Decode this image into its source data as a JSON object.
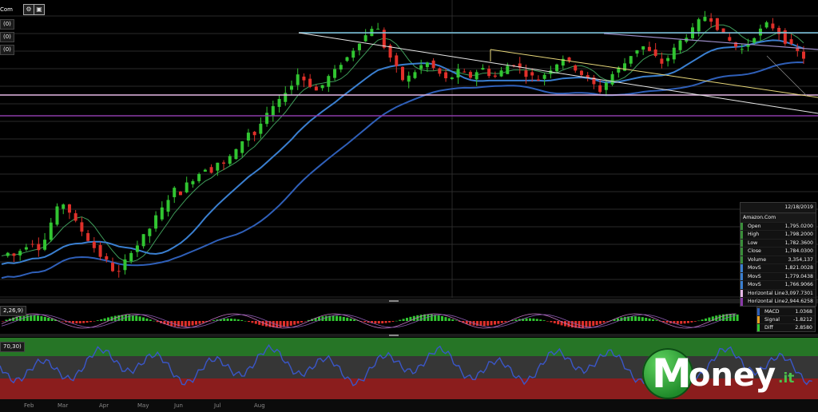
{
  "header": {
    "symbol_fragment": "Com"
  },
  "indicator_chips": [
    "(0)",
    "(0)",
    "(0)"
  ],
  "ohlc_panel": {
    "date": "12/18/2019",
    "symbol": "Amazon.Com",
    "rows": [
      {
        "label": "Open",
        "value": "1,795.0200"
      },
      {
        "label": "High",
        "value": "1,798.2000"
      },
      {
        "label": "Low",
        "value": "1,782.3600"
      },
      {
        "label": "Close",
        "value": "1,784.0300"
      },
      {
        "label": "Volume",
        "value": "3,354,137"
      },
      {
        "label": "MovS",
        "value": "1,821.0028"
      },
      {
        "label": "MovS",
        "value": "1,779.0438"
      },
      {
        "label": "MovS",
        "value": "1,766.9066"
      },
      {
        "label": "Horizontal Line",
        "value": "3,097.7301"
      },
      {
        "label": "Horizontal Line",
        "value": "2,944.6258"
      }
    ]
  },
  "macd": {
    "params_label": "2,26,9)",
    "rows": [
      {
        "label": "MACD",
        "value": "1.0368"
      },
      {
        "label": "Signal",
        "value": "-1.8212"
      },
      {
        "label": "Diff",
        "value": "2.8580"
      }
    ]
  },
  "rsi": {
    "params_label": "70,30)"
  },
  "months": [
    "Feb",
    "Mar",
    "Apr",
    "May",
    "Jun",
    "Jul",
    "Aug"
  ],
  "logo": {
    "letter": "M",
    "rest": "oney",
    "suffix": ".it"
  },
  "colors": {
    "up": "#31c531",
    "down": "#e0302a",
    "ma_fast": "#3f9c5a",
    "ma_mid": "#3a7fd0",
    "ma_slow": "#2f5fb8",
    "hline_top": "#7ec8e3",
    "hline_pink": "#e6b8e6",
    "hline_purple": "#8a3aa8",
    "trend_white": "#e8e8e8",
    "trend_yellow": "#e8d87a",
    "trend_lavender": "#9c8ec8",
    "rsi_band_top": "#2d8a2d",
    "rsi_band_bottom": "#a32222",
    "rsi_line": "#3a56c8"
  },
  "chart_data": {
    "type": "candlestick",
    "title": "Amazon.Com",
    "price_series_relative": [
      0.1,
      0.11,
      0.1,
      0.12,
      0.14,
      0.15,
      0.13,
      0.16,
      0.22,
      0.27,
      0.29,
      0.26,
      0.22,
      0.19,
      0.16,
      0.13,
      0.1,
      0.08,
      0.05,
      0.04,
      0.08,
      0.12,
      0.14,
      0.17,
      0.2,
      0.24,
      0.27,
      0.31,
      0.34,
      0.33,
      0.36,
      0.38,
      0.4,
      0.42,
      0.41,
      0.44,
      0.43,
      0.46,
      0.48,
      0.52,
      0.55,
      0.54,
      0.58,
      0.61,
      0.64,
      0.66,
      0.7,
      0.72,
      0.76,
      0.74,
      0.72,
      0.7,
      0.72,
      0.75,
      0.77,
      0.8,
      0.82,
      0.85,
      0.88,
      0.9,
      0.93,
      0.92,
      0.86,
      0.82,
      0.78,
      0.74,
      0.75,
      0.77,
      0.79,
      0.8,
      0.78,
      0.76,
      0.74,
      0.75,
      0.77,
      0.76,
      0.75,
      0.77,
      0.78,
      0.76,
      0.75,
      0.77,
      0.79,
      0.8,
      0.78,
      0.76,
      0.75,
      0.74,
      0.76,
      0.78,
      0.8,
      0.82,
      0.8,
      0.78,
      0.76,
      0.74,
      0.72,
      0.7,
      0.73,
      0.76,
      0.78,
      0.8,
      0.83,
      0.85,
      0.86,
      0.84,
      0.82,
      0.8,
      0.82,
      0.85,
      0.88,
      0.9,
      0.92,
      0.95,
      0.97,
      0.96,
      0.93,
      0.9,
      0.88,
      0.86,
      0.85,
      0.87,
      0.9,
      0.92,
      0.94,
      0.93,
      0.91,
      0.88,
      0.86,
      0.84,
      0.82
    ],
    "horizontal_lines": [
      {
        "label": "Horizontal Line",
        "value": 3097.7301
      },
      {
        "label": "Horizontal Line",
        "value": 2944.6258
      }
    ],
    "last_bar": {
      "date": "12/18/2019",
      "open": 1795.02,
      "high": 1798.2,
      "low": 1782.36,
      "close": 1784.03,
      "volume": 3354137
    },
    "moving_averages": [
      1821.0028,
      1779.0438,
      1766.9066
    ],
    "macd": {
      "macd": 1.0368,
      "signal": -1.8212,
      "diff": 2.858
    },
    "xlabel": "",
    "ylabel": "",
    "grid": true,
    "legend": "right"
  }
}
